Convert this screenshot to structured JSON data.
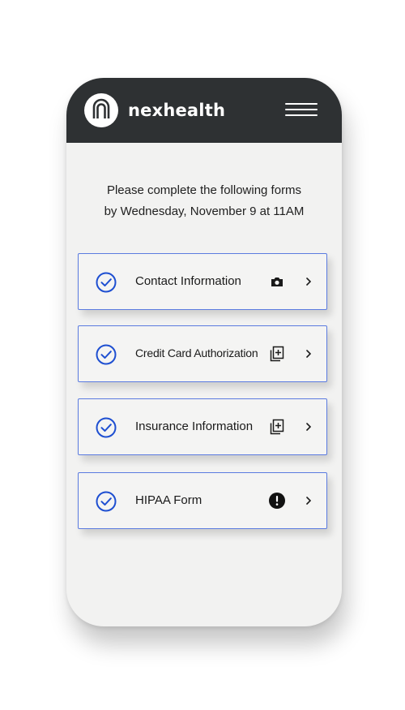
{
  "brand": {
    "name": "nexhealth",
    "logo_icon": "nexhealth-n-logo",
    "header_color": "#2e3133"
  },
  "header": {
    "menu_icon": "hamburger-menu-icon"
  },
  "instructions": {
    "line1": "Please complete the following forms",
    "line2": "by Wednesday, November 9 at 11AM"
  },
  "forms": [
    {
      "label": "Contact Information",
      "status_icon": "camera-icon",
      "completed": true
    },
    {
      "label": "Credit Card Authorization",
      "status_icon": "copy-add-icon",
      "completed": true
    },
    {
      "label": "Insurance Information",
      "status_icon": "copy-add-icon",
      "completed": true
    },
    {
      "label": "HIPAA Form",
      "status_icon": "alert-icon",
      "completed": true
    }
  ],
  "colors": {
    "accent": "#1e4fd1",
    "card_border": "#5b7be0",
    "background": "#f2f2f1"
  }
}
